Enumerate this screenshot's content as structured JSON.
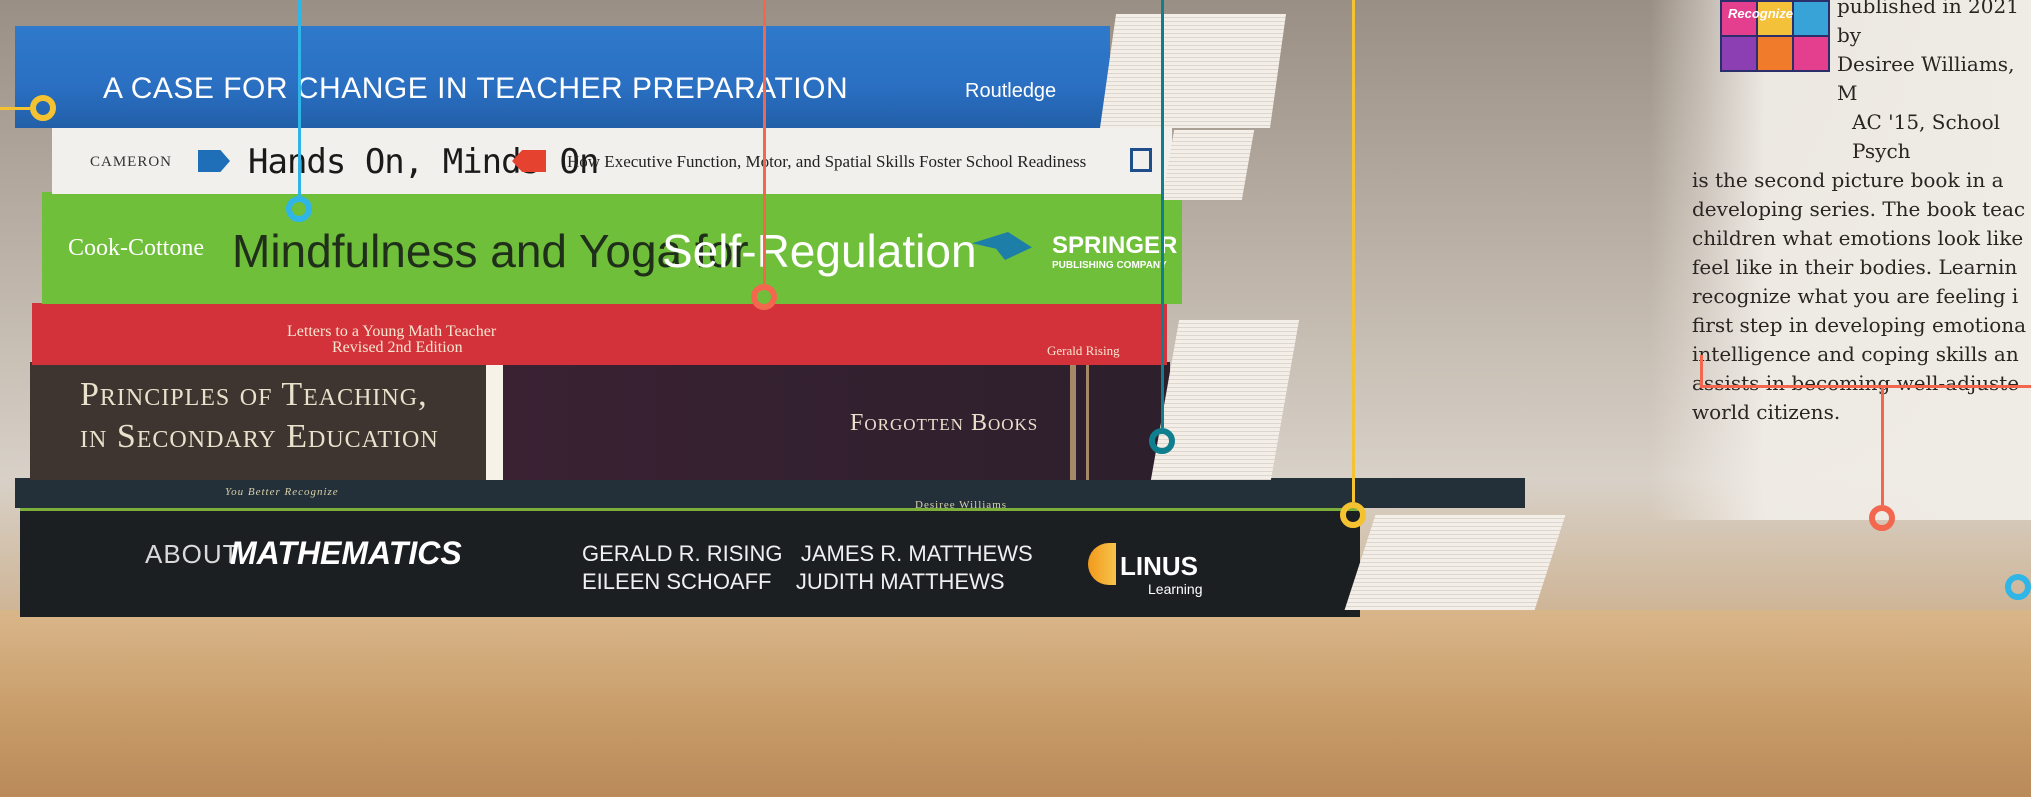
{
  "books": [
    {
      "id": "case-for-change",
      "title": "A CASE FOR CHANGE IN TEACHER PREPARATION",
      "publisher": "Routledge",
      "color": "#2a6fc2"
    },
    {
      "id": "hands-on",
      "author": "CAMERON",
      "title": "Hands On, Minds On",
      "subtitle": "How Executive Function, Motor, and Spatial Skills Foster School Readiness",
      "color": "#f2f0ec"
    },
    {
      "id": "mindfulness",
      "author": "Cook-Cottone",
      "title_a": "Mindfulness and Yoga for ",
      "title_b": "Self-Regulation",
      "publisher": "SPRINGER",
      "publisher_sub": "PUBLISHING COMPANY",
      "color": "#6fbf3b"
    },
    {
      "id": "letters",
      "title_line1": "Letters to a Young Math Teacher",
      "title_line2": "Revised 2nd Edition",
      "author": "Gerald Rising",
      "color": "#d3323a"
    },
    {
      "id": "principles",
      "title_line1": "Principles of Teaching,",
      "title_line2": "in Secondary Education",
      "publisher": "Forgotten Books",
      "color": "#3a2c38"
    },
    {
      "id": "recognize",
      "title": "You Better Recognize",
      "author": "Desiree Williams",
      "color": "#23303a"
    },
    {
      "id": "about-math",
      "title_a": "ABOUT ",
      "title_b": "MATHEMATICS",
      "authors_line1": "GERALD R. RISING   JAMES R. MATTHEWS",
      "authors_line2": "EILEEN SCHOAFF    JUDITH MATTHEWS",
      "publisher": "LINUS",
      "publisher_sub": "Learning",
      "color": "#1c1f22"
    }
  ],
  "callout": {
    "lines": [
      "published in 2021 by",
      "Desiree Williams, M",
      "AC '15, School Psych",
      "is the second picture book in a",
      "developing series. The book teac",
      "children what emotions look like",
      "feel like in their bodies. Learnin",
      "recognize what you are feeling i",
      "first step in developing emotiona",
      "intelligence and coping skills an",
      "assists in becoming well-adjuste",
      "world citizens."
    ],
    "thumb_label": "Recognize"
  },
  "marker_colors": {
    "yellow": "#f5c231",
    "cyan": "#2fb6e6",
    "coral": "#f2674e",
    "teal": "#0f7f8f"
  }
}
